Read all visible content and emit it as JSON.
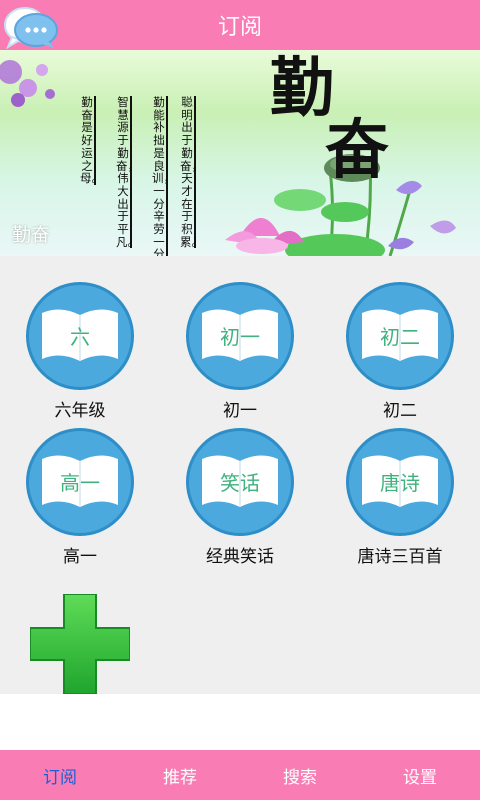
{
  "header": {
    "title": "订阅",
    "chat_icon": "chat-bubbles-icon"
  },
  "banner": {
    "big_title_line1": "勤",
    "big_title_line2": "奋",
    "caption": "勤奋",
    "poem_columns": [
      "聪明出于勤奋，天才在于积累。",
      "勤能补拙是良训，一分辛劳一分才。",
      "智慧源于勤奋，伟大出于平凡。",
      "勤奋是好运之母。"
    ]
  },
  "subscriptions": [
    {
      "book_text": "六",
      "label": "六年级"
    },
    {
      "book_text": "初一",
      "label": "初一"
    },
    {
      "book_text": "初二",
      "label": "初二"
    },
    {
      "book_text": "高一",
      "label": "高一"
    },
    {
      "book_text": "笑话",
      "label": "经典笑话"
    },
    {
      "book_text": "唐诗",
      "label": "唐诗三百首"
    }
  ],
  "add_button": {
    "icon": "plus-icon"
  },
  "tabs": [
    {
      "label": "订阅",
      "active": true
    },
    {
      "label": "推荐",
      "active": false
    },
    {
      "label": "搜索",
      "active": false
    },
    {
      "label": "设置",
      "active": false
    }
  ],
  "colors": {
    "header": "#f97db4",
    "tab_active": "#1a5fd6",
    "circle": "#4ba9dd",
    "book_text": "#3fb27d",
    "plus": "#2fc140"
  }
}
